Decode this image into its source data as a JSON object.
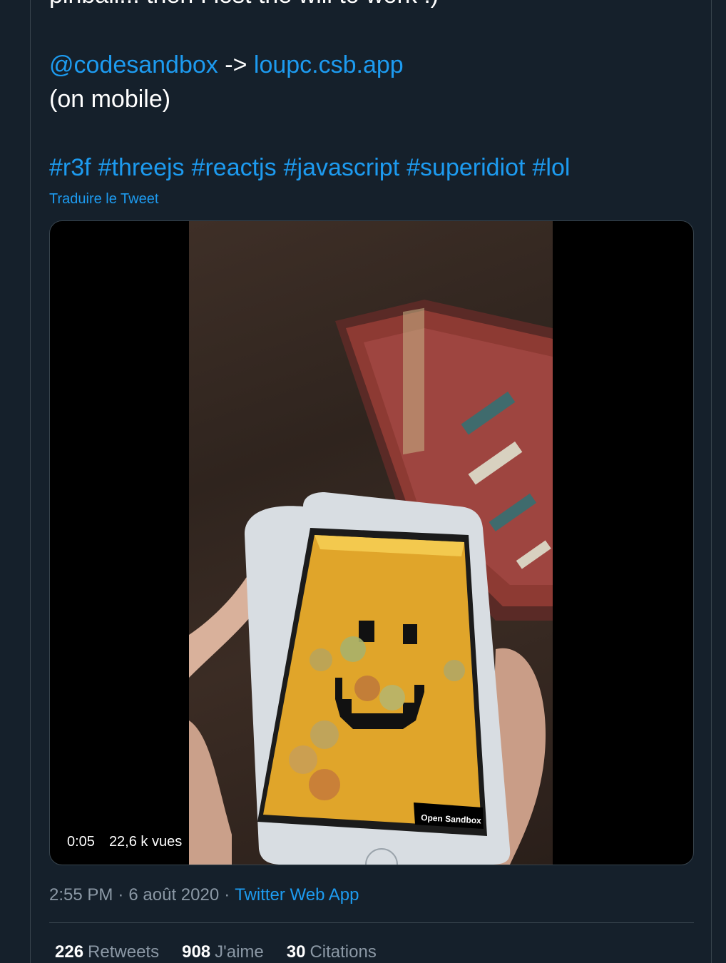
{
  "tweet": {
    "clipped_text": "pinball... then I lost the will to work :)",
    "mention": "@codesandbox",
    "arrow": "->",
    "link": "loupc.csb.app",
    "mobile_note": "(on mobile)",
    "hashtags": [
      "#r3f",
      "#threejs",
      "#reactjs",
      "#javascript",
      "#superidiot",
      "#lol"
    ],
    "translate_label": "Traduire le Tweet"
  },
  "video": {
    "time": "0:05",
    "views": "22,6 k vues",
    "phone_button": "Open Sandbox"
  },
  "meta": {
    "time": "2:55 PM",
    "separator": "·",
    "date": "6 août 2020",
    "app": "Twitter Web App"
  },
  "stats": {
    "retweets_count": "226",
    "retweets_label": "Retweets",
    "likes_count": "908",
    "likes_label": "J'aime",
    "quotes_count": "30",
    "quotes_label": "Citations"
  },
  "colors": {
    "background": "#15202b",
    "accent": "#1d9bf0",
    "muted": "#8b98a5",
    "border": "#38444d"
  }
}
